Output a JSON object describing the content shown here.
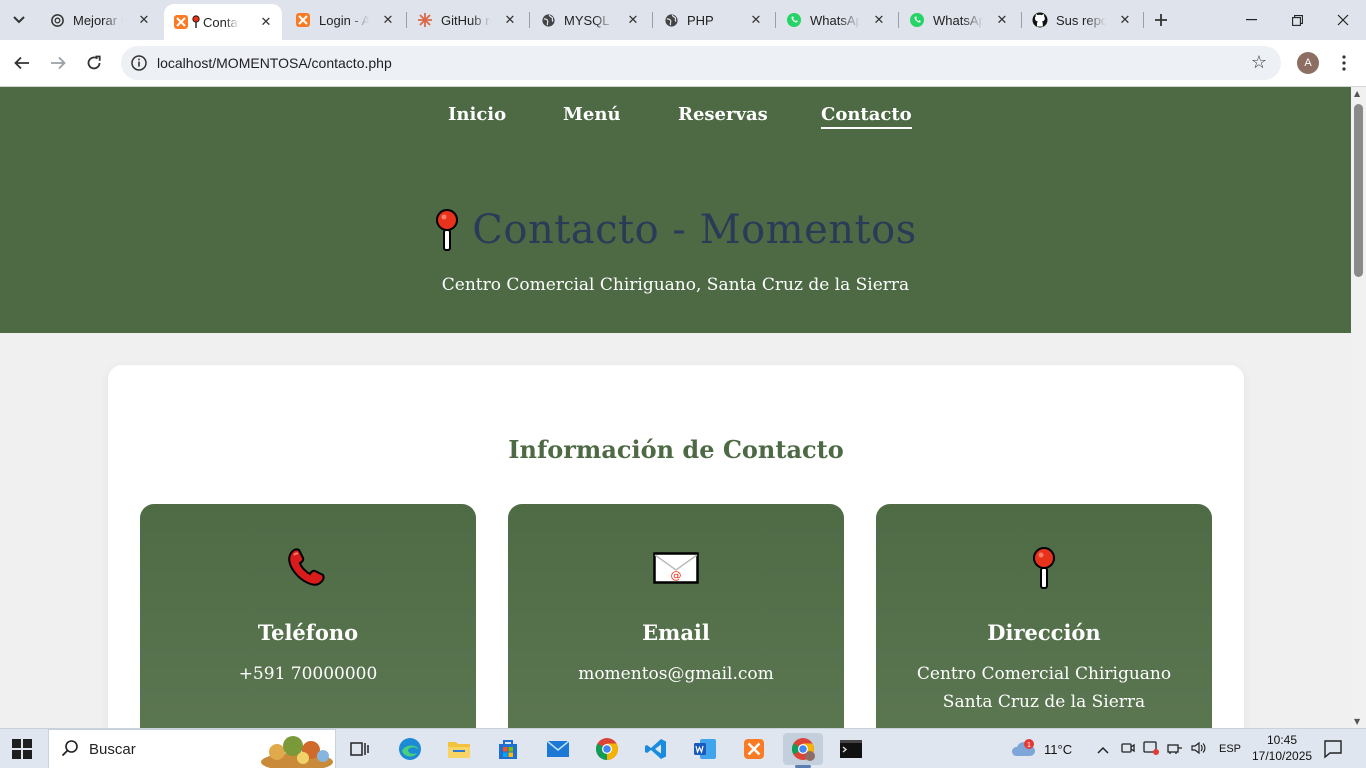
{
  "browser": {
    "tabs": [
      {
        "title": "Mejorar su",
        "icon": "chatgpt-icon"
      },
      {
        "title": "Contacto",
        "icon": "xampp-icon",
        "active": true
      },
      {
        "title": "Login - Ad",
        "icon": "xampp-icon"
      },
      {
        "title": "GitHub re",
        "icon": "claude-icon"
      },
      {
        "title": "MYSQL",
        "icon": "globe-icon"
      },
      {
        "title": "PHP",
        "icon": "globe-icon"
      },
      {
        "title": "WhatsApp",
        "icon": "whatsapp-icon"
      },
      {
        "title": "WhatsApp",
        "icon": "whatsapp-icon"
      },
      {
        "title": "Sus repos",
        "icon": "github-icon"
      }
    ],
    "url": "localhost/MOMENTOSA/contacto.php",
    "profile_initial": "A"
  },
  "page": {
    "nav": {
      "inicio": "Inicio",
      "menu": "Menú",
      "reservas": "Reservas",
      "contacto": "Contacto"
    },
    "hero": {
      "title": "Contacto - Momentos",
      "subtitle": "Centro Comercial Chiriguano, Santa Cruz de la Sierra"
    },
    "section_title": "Información de Contacto",
    "cards": [
      {
        "icon": "telephone-icon",
        "title": "Teléfono",
        "line1": "+591 70000000",
        "line2": ""
      },
      {
        "icon": "envelope-icon",
        "title": "Email",
        "line1": "momentos@gmail.com",
        "line2": ""
      },
      {
        "icon": "pushpin-icon",
        "title": "Dirección",
        "line1": "Centro Comercial Chiriguano",
        "line2": "Santa Cruz de la Sierra"
      }
    ],
    "colors": {
      "hero_bg": "#4d6a45",
      "title_blue": "#2b3a57",
      "accent_green": "#4d6a45"
    }
  },
  "taskbar": {
    "search_placeholder": "Buscar",
    "weather": "11°C",
    "weather_badge": "1",
    "language": "ESP",
    "time": "10:45",
    "date": "17/10/2025"
  }
}
